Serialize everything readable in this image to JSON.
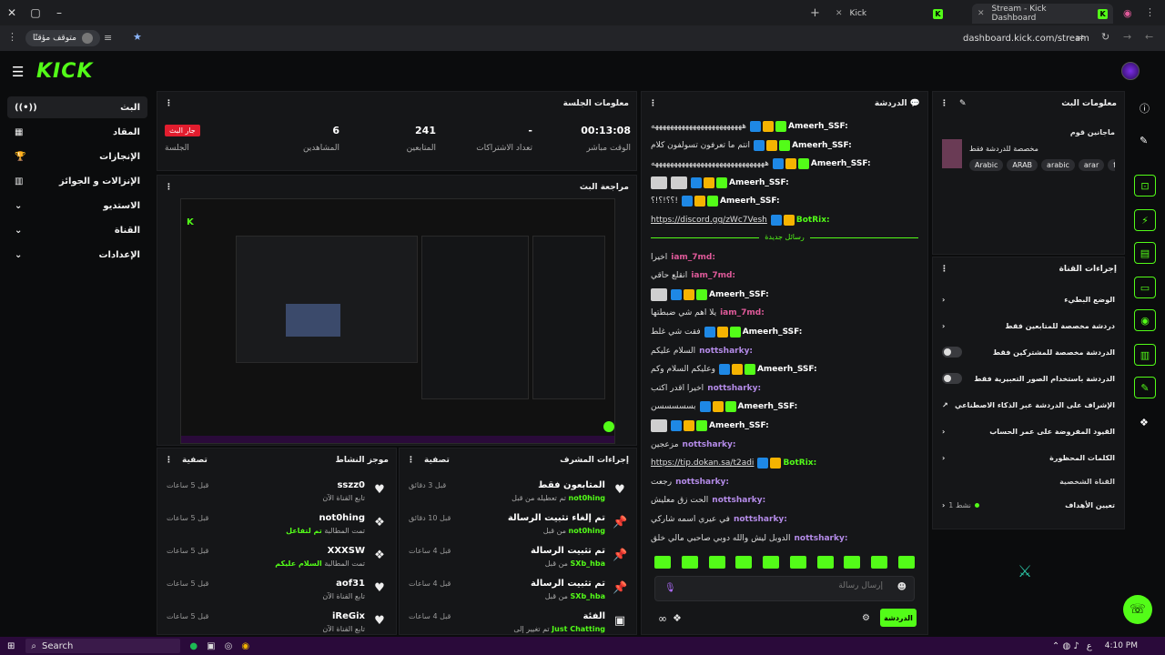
{
  "browser": {
    "tab1": "Kick",
    "tab2": "Stream - Kick Dashboard",
    "pill": "متوقف مؤقتًا",
    "url": "dashboard.kick.com/stream"
  },
  "logo": "KICK",
  "sidebar": {
    "items": [
      {
        "label": "البث"
      },
      {
        "label": "المقاد"
      },
      {
        "label": "الإنجازات"
      },
      {
        "label": "الإنزالات و الجوائز"
      },
      {
        "label": "الاستديو"
      },
      {
        "label": "القناة"
      },
      {
        "label": "الإعدادات"
      }
    ]
  },
  "session": {
    "title": "معلومات الجلسة",
    "stats": [
      {
        "value": "00:13:08",
        "label": "الوقت مباشر"
      },
      {
        "value": "-",
        "label": "تعداد الاشتراكات"
      },
      {
        "value": "241",
        "label": "المتابعين"
      },
      {
        "value": "6",
        "label": "المشاهدين"
      },
      {
        "value": "جار البث",
        "label": "الجلسة"
      }
    ]
  },
  "preview": {
    "title": "مراجعة البث"
  },
  "activity": {
    "title": "موجز النشاط",
    "filter": "تصفية",
    "rows": [
      {
        "name": "sszz0",
        "sub": "تابع القناة الآن",
        "hl": "",
        "time": "قبل 5 ساعات",
        "icon": "heart-icon"
      },
      {
        "name": "not0hing",
        "sub": "تمت المطالبة",
        "hl": "تم لتفاعل",
        "time": "قبل 5 ساعات",
        "icon": "gift-icon"
      },
      {
        "name": "XXXSW",
        "sub": "تمت المطالبة",
        "hl": "السلام عليكم",
        "time": "قبل 5 ساعات",
        "icon": "gift-icon"
      },
      {
        "name": "aof31",
        "sub": "تابع القناة الآن",
        "hl": "",
        "time": "قبل 5 ساعات",
        "icon": "heart-icon"
      },
      {
        "name": "iReGix",
        "sub": "تابع القناة الآن",
        "hl": "",
        "time": "قبل 5 ساعات",
        "icon": "heart-icon"
      }
    ]
  },
  "modactions": {
    "title": "إجراءات المشرف",
    "filter": "تصفية",
    "rows": [
      {
        "name": "المتابعون فقط",
        "sub": "تم تعطيله من قبل",
        "hl": "not0hing",
        "time": "قبل 3 دقائق",
        "icon": "heart-icon"
      },
      {
        "name": "تم إلغاء تثبيت الرسالة",
        "sub": "من قبل",
        "hl": "not0hing",
        "time": "قبل 10 دقائق",
        "icon": "pin-icon"
      },
      {
        "name": "تم تثبيت الرسالة",
        "sub": "من قبل",
        "hl": "SXb_hba",
        "time": "قبل 4 ساعات",
        "icon": "pin-icon"
      },
      {
        "name": "تم تثبيت الرسالة",
        "sub": "من قبل",
        "hl": "SXb_hba",
        "time": "قبل 4 ساعات",
        "icon": "pin-icon"
      },
      {
        "name": "الفئة",
        "sub": "تم تغيير إلى",
        "hl": "Just Chatting",
        "time": "قبل 4 ساعات",
        "icon": "category-icon"
      }
    ]
  },
  "chat": {
    "title": "الدردشة",
    "divider": "رسائل جديدة",
    "placeholder": "إرسال رسالة",
    "send": "الدردشة",
    "lines": [
      {
        "user": "Ameerh_SSF:",
        "msg": "ههههههههههههههههههههههههه",
        "color": "#ffffff",
        "badges": 3
      },
      {
        "user": "Ameerh_SSF:",
        "msg": "انتم ما تعرفون تسولفون كلام",
        "color": "#ffffff",
        "badges": 3
      },
      {
        "user": "Ameerh_SSF:",
        "msg": "ههههههههههههههههههههههههههههههه",
        "color": "#ffffff",
        "badges": 3
      },
      {
        "user": "Ameerh_SSF:",
        "msg": "",
        "color": "#ffffff",
        "badges": 3,
        "emotes": 2
      },
      {
        "user": "Ameerh_SSF:",
        "msg": "!؟؟!؟!؟",
        "color": "#ffffff",
        "badges": 3
      },
      {
        "user": "BotRix:",
        "msg": "https://discord.gg/zWc7Vesh",
        "color": "#53fc18",
        "badges": 2,
        "link": true
      },
      {
        "user": "iam_7md:",
        "msg": "اخيرا",
        "color": "#e05a9a",
        "badges": 0
      },
      {
        "user": "iam_7md:",
        "msg": "انقلع حاقي",
        "color": "#e05a9a",
        "badges": 0
      },
      {
        "user": "Ameerh_SSF:",
        "msg": "",
        "color": "#ffffff",
        "badges": 3,
        "emotes": 1
      },
      {
        "user": "iam_7md:",
        "msg": "يلا اهم شي ضبطتها",
        "color": "#e05a9a",
        "badges": 0
      },
      {
        "user": "Ameerh_SSF:",
        "msg": "فقت شي غلط",
        "color": "#ffffff",
        "badges": 3
      },
      {
        "user": "nottsharky:",
        "msg": "السلام عليكم",
        "color": "#b48be8",
        "badges": 0
      },
      {
        "user": "Ameerh_SSF:",
        "msg": "وعليكم السلام وكم",
        "color": "#ffffff",
        "badges": 3
      },
      {
        "user": "nottsharky:",
        "msg": "اخيرا اقدر اكتب",
        "color": "#b48be8",
        "badges": 0
      },
      {
        "user": "Ameerh_SSF:",
        "msg": "بسسسسسن",
        "color": "#ffffff",
        "badges": 3
      },
      {
        "user": "Ameerh_SSF:",
        "msg": "",
        "color": "#ffffff",
        "badges": 3,
        "emotes": 1
      },
      {
        "user": "nottsharky:",
        "msg": "مزعجين",
        "color": "#b48be8",
        "badges": 0
      },
      {
        "user": "BotRix:",
        "msg": "https://tip.dokan.sa/t2adi",
        "color": "#53fc18",
        "badges": 2,
        "link": true
      },
      {
        "user": "nottsharky:",
        "msg": "رجعت",
        "color": "#b48be8",
        "badges": 0
      },
      {
        "user": "nottsharky:",
        "msg": "الحت زق معليش",
        "color": "#b48be8",
        "badges": 0
      },
      {
        "user": "nottsharky:",
        "msg": "في عيري اسمه شاركي",
        "color": "#b48be8",
        "badges": 0
      },
      {
        "user": "nottsharky:",
        "msg": "الدوبل ليش والله دوبي صاحبي مالي خلق",
        "color": "#b48be8",
        "badges": 0
      }
    ]
  },
  "streaminfo": {
    "title": "معلومات البث",
    "name": "ماجانين قوم",
    "category": "مخصصة للدردشة فقط",
    "tags": [
      "Arabic",
      "ARAB",
      "arabic",
      "arar",
      "fu"
    ]
  },
  "channelactions": {
    "title": "إجراءات القناة",
    "rows": [
      {
        "label": "الوضع البطيء",
        "ctrl": "chevron"
      },
      {
        "label": "دردشة مخصصة للمتابعين فقط",
        "ctrl": "chevron"
      },
      {
        "label": "الدردشة مخصصة للمشتركين فقط",
        "ctrl": "toggle"
      },
      {
        "label": "الدردشة باستخدام الصور التعبيرية فقط",
        "ctrl": "toggle"
      },
      {
        "label": "الإشراف على الدردشة عبر الذكاء الاصطناعي",
        "ctrl": "external"
      },
      {
        "label": "القيود المفروضة على عمر الحساب",
        "ctrl": "chevron"
      },
      {
        "label": "الكلمات المحظورة",
        "ctrl": "chevron"
      }
    ],
    "section": "القناة الشخصية",
    "goals": "تعيين الأهداف",
    "goals_status": "1 نشط"
  },
  "taskbar": {
    "search": "Search",
    "time": "4:10 PM",
    "lang": "ع"
  }
}
